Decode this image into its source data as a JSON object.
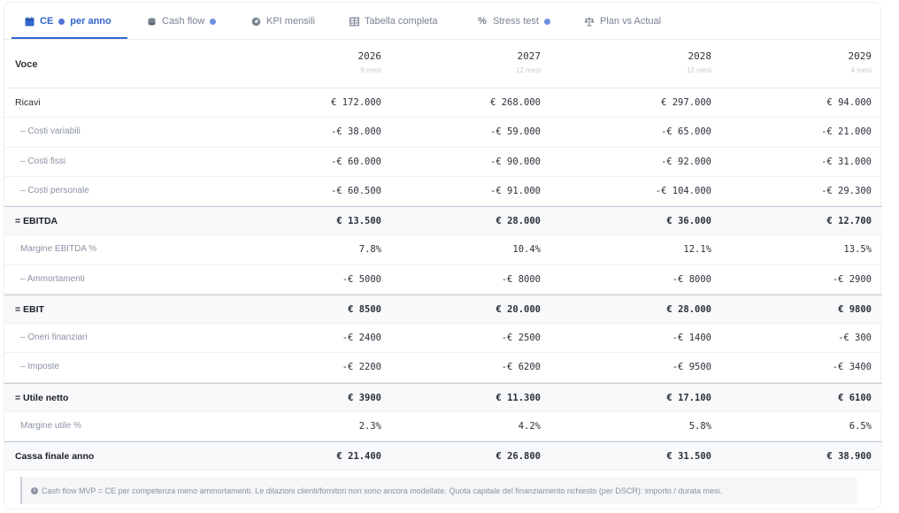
{
  "tabs": [
    {
      "label": "CE",
      "suffix": "per anno",
      "icon": "calendar-icon",
      "active": true,
      "info": true
    },
    {
      "label": "Cash flow",
      "icon": "coins-icon",
      "info": true
    },
    {
      "label": "KPI mensili",
      "icon": "gauge-icon",
      "info": false
    },
    {
      "label": "Tabella completa",
      "icon": "table-icon",
      "info": false
    },
    {
      "label": "Stress test",
      "icon": "percent-icon",
      "info": true
    },
    {
      "label": "Plan vs Actual",
      "icon": "scales-icon",
      "info": false
    }
  ],
  "table": {
    "voce_header": "Voce",
    "years": [
      {
        "year": "2026",
        "months": "8 mesi"
      },
      {
        "year": "2027",
        "months": "12 mesi"
      },
      {
        "year": "2028",
        "months": "12 mesi"
      },
      {
        "year": "2029",
        "months": "4 mesi"
      }
    ],
    "rows": [
      {
        "label": "Ricavi",
        "style": "normal",
        "values": [
          "€ 172.000",
          "€ 268.000",
          "€ 297.000",
          "€ 94.000"
        ]
      },
      {
        "label": "– Costi variabili",
        "style": "sub",
        "values": [
          "-€ 38.000",
          "-€ 59.000",
          "-€ 65.000",
          "-€ 21.000"
        ]
      },
      {
        "label": "– Costi fissi",
        "style": "sub",
        "values": [
          "-€ 60.000",
          "-€ 90.000",
          "-€ 92.000",
          "-€ 31.000"
        ]
      },
      {
        "label": "– Costi personale",
        "style": "sub",
        "values": [
          "-€ 60.500",
          "-€ 91.000",
          "-€ 104.000",
          "-€ 29.300"
        ]
      },
      {
        "label": "= EBITDA",
        "style": "bold",
        "values": [
          "€ 13.500",
          "€ 28.000",
          "€ 36.000",
          "€ 12.700"
        ]
      },
      {
        "label": "Margine EBITDA %",
        "style": "sub",
        "values": [
          "7.8%",
          "10.4%",
          "12.1%",
          "13.5%"
        ]
      },
      {
        "label": "– Ammortamenti",
        "style": "sub",
        "values": [
          "-€ 5000",
          "-€ 8000",
          "-€ 8000",
          "-€ 2900"
        ]
      },
      {
        "label": "= EBIT",
        "style": "bold",
        "values": [
          "€ 8500",
          "€ 20.000",
          "€ 28.000",
          "€ 9800"
        ]
      },
      {
        "label": "– Oneri finanziari",
        "style": "sub",
        "values": [
          "-€ 2400",
          "-€ 2500",
          "-€ 1400",
          "-€ 300"
        ]
      },
      {
        "label": "– Imposte",
        "style": "sub",
        "values": [
          "-€ 2200",
          "-€ 6200",
          "-€ 9500",
          "-€ 3400"
        ]
      },
      {
        "label": "= Utile netto",
        "style": "bold",
        "values": [
          "€ 3900",
          "€ 11.300",
          "€ 17.100",
          "€ 6100"
        ]
      },
      {
        "label": "Margine utile %",
        "style": "sub",
        "values": [
          "2.3%",
          "4.2%",
          "5.8%",
          "6.5%"
        ]
      },
      {
        "label": "Cassa finale anno",
        "style": "bold",
        "values": [
          "€ 21.400",
          "€ 26.800",
          "€ 31.500",
          "€ 38.900"
        ]
      }
    ]
  },
  "note": "Cash flow MVP = CE per competenza meno ammortamenti. Le dilazioni clienti/fornitori non sono ancora modellate. Quota capitale del finanziamento richiesto (per DSCR): importo / durata mesi.",
  "colors": {
    "accent": "#3366cc",
    "muted_text": "#8a92a2",
    "border": "#e6e9ee"
  }
}
